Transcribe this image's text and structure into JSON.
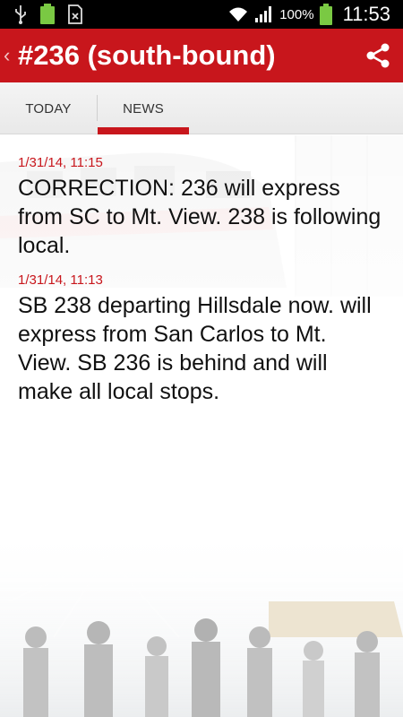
{
  "status_bar": {
    "battery_pct": "100%",
    "clock": "11:53",
    "battery_small_label": "100%",
    "icons": [
      "usb-icon",
      "battery-small-icon",
      "sim-icon",
      "wifi-icon",
      "signal-icon",
      "battery-icon"
    ]
  },
  "action_bar": {
    "back_glyph": "‹",
    "title": "#236 (south-bound)",
    "share_icon": "share-icon"
  },
  "tabs": [
    {
      "label": "TODAY",
      "selected": false
    },
    {
      "label": "NEWS",
      "selected": true
    }
  ],
  "news": [
    {
      "time": "1/31/14, 11:15",
      "text": "CORRECTION: 236 will express from SC to Mt. View. 238 is following local."
    },
    {
      "time": "1/31/14, 11:13",
      "text": "SB 238 departing Hillsdale now. will express from San Carlos to Mt. View. SB 236 is behind and will make all local stops."
    }
  ],
  "colors": {
    "accent": "#c8161c",
    "status_bar": "#000000",
    "tab_bar": "#f0f0f0",
    "text": "#111111"
  }
}
